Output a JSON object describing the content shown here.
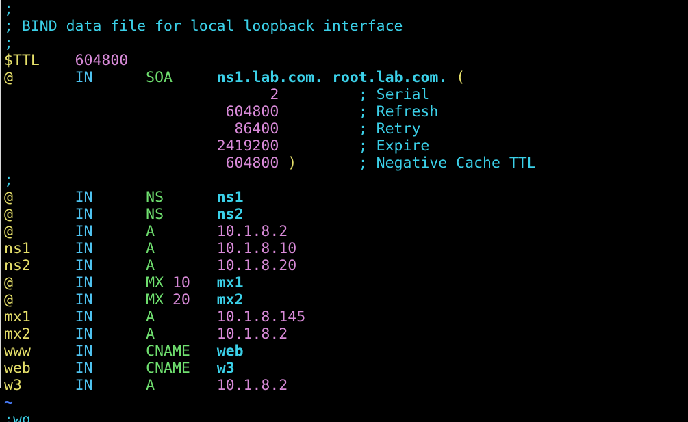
{
  "editor": {
    "lines": [
      [
        {
          "t": ";",
          "c": "comment"
        }
      ],
      [
        {
          "t": "; BIND data file for local loopback interface",
          "c": "comment"
        }
      ],
      [
        {
          "t": ";",
          "c": "comment"
        }
      ],
      [
        {
          "t": "$TTL",
          "c": "ttlkw"
        },
        {
          "t": "    ",
          "c": ""
        },
        {
          "t": "604800",
          "c": "number"
        }
      ],
      [
        {
          "t": "@",
          "c": "owner"
        },
        {
          "t": "       ",
          "c": ""
        },
        {
          "t": "IN",
          "c": "class"
        },
        {
          "t": "      ",
          "c": ""
        },
        {
          "t": "SOA",
          "c": "type"
        },
        {
          "t": "     ",
          "c": ""
        },
        {
          "t": "ns1.lab.com.",
          "c": "name"
        },
        {
          "t": " ",
          "c": ""
        },
        {
          "t": "root.lab.com.",
          "c": "name"
        },
        {
          "t": " ",
          "c": ""
        },
        {
          "t": "(",
          "c": "paren"
        }
      ],
      [
        {
          "t": "                              ",
          "c": ""
        },
        {
          "t": "2",
          "c": "number"
        },
        {
          "t": "         ",
          "c": ""
        },
        {
          "t": "; Serial",
          "c": "comment"
        }
      ],
      [
        {
          "t": "                         ",
          "c": ""
        },
        {
          "t": "604800",
          "c": "number"
        },
        {
          "t": "         ",
          "c": ""
        },
        {
          "t": "; Refresh",
          "c": "comment"
        }
      ],
      [
        {
          "t": "                          ",
          "c": ""
        },
        {
          "t": "86400",
          "c": "number"
        },
        {
          "t": "         ",
          "c": ""
        },
        {
          "t": "; Retry",
          "c": "comment"
        }
      ],
      [
        {
          "t": "                        ",
          "c": ""
        },
        {
          "t": "2419200",
          "c": "number"
        },
        {
          "t": "         ",
          "c": ""
        },
        {
          "t": "; Expire",
          "c": "comment"
        }
      ],
      [
        {
          "t": "                         ",
          "c": ""
        },
        {
          "t": "604800",
          "c": "number"
        },
        {
          "t": " ",
          "c": ""
        },
        {
          "t": ")",
          "c": "paren"
        },
        {
          "t": "       ",
          "c": ""
        },
        {
          "t": "; Negative Cache TTL",
          "c": "comment"
        }
      ],
      [
        {
          "t": ";",
          "c": "comment"
        }
      ],
      [
        {
          "t": "@",
          "c": "owner"
        },
        {
          "t": "       ",
          "c": ""
        },
        {
          "t": "IN",
          "c": "class"
        },
        {
          "t": "      ",
          "c": ""
        },
        {
          "t": "NS",
          "c": "type"
        },
        {
          "t": "      ",
          "c": ""
        },
        {
          "t": "ns1",
          "c": "name"
        }
      ],
      [
        {
          "t": "@",
          "c": "owner"
        },
        {
          "t": "       ",
          "c": ""
        },
        {
          "t": "IN",
          "c": "class"
        },
        {
          "t": "      ",
          "c": ""
        },
        {
          "t": "NS",
          "c": "type"
        },
        {
          "t": "      ",
          "c": ""
        },
        {
          "t": "ns2",
          "c": "name"
        }
      ],
      [
        {
          "t": "@",
          "c": "owner"
        },
        {
          "t": "       ",
          "c": ""
        },
        {
          "t": "IN",
          "c": "class"
        },
        {
          "t": "      ",
          "c": ""
        },
        {
          "t": "A",
          "c": "type"
        },
        {
          "t": "       ",
          "c": ""
        },
        {
          "t": "10.1.8.2",
          "c": "number"
        }
      ],
      [
        {
          "t": "ns1",
          "c": "owner"
        },
        {
          "t": "     ",
          "c": ""
        },
        {
          "t": "IN",
          "c": "class"
        },
        {
          "t": "      ",
          "c": ""
        },
        {
          "t": "A",
          "c": "type"
        },
        {
          "t": "       ",
          "c": ""
        },
        {
          "t": "10.1.8.10",
          "c": "number"
        }
      ],
      [
        {
          "t": "ns2",
          "c": "owner"
        },
        {
          "t": "     ",
          "c": ""
        },
        {
          "t": "IN",
          "c": "class"
        },
        {
          "t": "      ",
          "c": ""
        },
        {
          "t": "A",
          "c": "type"
        },
        {
          "t": "       ",
          "c": ""
        },
        {
          "t": "10.1.8.20",
          "c": "number"
        }
      ],
      [
        {
          "t": "@",
          "c": "owner"
        },
        {
          "t": "       ",
          "c": ""
        },
        {
          "t": "IN",
          "c": "class"
        },
        {
          "t": "      ",
          "c": ""
        },
        {
          "t": "MX",
          "c": "type"
        },
        {
          "t": " ",
          "c": ""
        },
        {
          "t": "10",
          "c": "number"
        },
        {
          "t": "   ",
          "c": ""
        },
        {
          "t": "mx1",
          "c": "name"
        }
      ],
      [
        {
          "t": "@",
          "c": "owner"
        },
        {
          "t": "       ",
          "c": ""
        },
        {
          "t": "IN",
          "c": "class"
        },
        {
          "t": "      ",
          "c": ""
        },
        {
          "t": "MX",
          "c": "type"
        },
        {
          "t": " ",
          "c": ""
        },
        {
          "t": "20",
          "c": "number"
        },
        {
          "t": "   ",
          "c": ""
        },
        {
          "t": "mx2",
          "c": "name"
        }
      ],
      [
        {
          "t": "mx1",
          "c": "owner"
        },
        {
          "t": "     ",
          "c": ""
        },
        {
          "t": "IN",
          "c": "class"
        },
        {
          "t": "      ",
          "c": ""
        },
        {
          "t": "A",
          "c": "type"
        },
        {
          "t": "       ",
          "c": ""
        },
        {
          "t": "10.1.8.145",
          "c": "number"
        }
      ],
      [
        {
          "t": "mx2",
          "c": "owner"
        },
        {
          "t": "     ",
          "c": ""
        },
        {
          "t": "IN",
          "c": "class"
        },
        {
          "t": "      ",
          "c": ""
        },
        {
          "t": "A",
          "c": "type"
        },
        {
          "t": "       ",
          "c": ""
        },
        {
          "t": "10.1.8.2",
          "c": "number"
        }
      ],
      [
        {
          "t": "www",
          "c": "owner"
        },
        {
          "t": "     ",
          "c": ""
        },
        {
          "t": "IN",
          "c": "class"
        },
        {
          "t": "      ",
          "c": ""
        },
        {
          "t": "CNAME",
          "c": "type"
        },
        {
          "t": "   ",
          "c": ""
        },
        {
          "t": "web",
          "c": "name"
        }
      ],
      [
        {
          "t": "web",
          "c": "owner"
        },
        {
          "t": "     ",
          "c": ""
        },
        {
          "t": "IN",
          "c": "class"
        },
        {
          "t": "      ",
          "c": ""
        },
        {
          "t": "CNAME",
          "c": "type"
        },
        {
          "t": "   ",
          "c": ""
        },
        {
          "t": "w3",
          "c": "name"
        }
      ],
      [
        {
          "t": "w3",
          "c": "owner"
        },
        {
          "t": "      ",
          "c": ""
        },
        {
          "t": "IN",
          "c": "class"
        },
        {
          "t": "      ",
          "c": ""
        },
        {
          "t": "A",
          "c": "type"
        },
        {
          "t": "       ",
          "c": ""
        },
        {
          "t": "10.1.8.2",
          "c": "number"
        }
      ],
      [
        {
          "t": "~",
          "c": "tilde"
        }
      ]
    ],
    "command_line": ":wq",
    "colors": {
      "background": "#000000",
      "comment": "#3bd0e8",
      "owner": "#e6e06a",
      "class": "#4fc3f0",
      "type": "#6fe06f",
      "name": "#3bd0e8",
      "number": "#d88ad8",
      "tilde": "#4a7fff"
    }
  }
}
